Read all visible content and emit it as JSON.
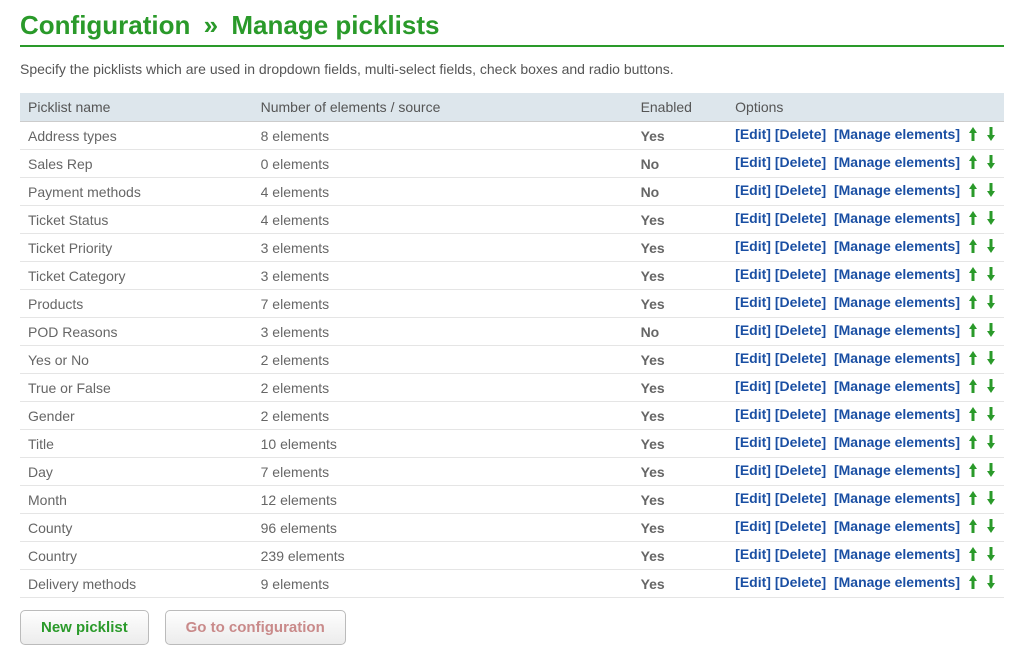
{
  "header": {
    "breadcrumb1": "Configuration",
    "sep": "»",
    "breadcrumb2": "Manage picklists"
  },
  "intro": "Specify the picklists which are used in dropdown fields, multi-select fields, check boxes and radio buttons.",
  "table": {
    "headers": {
      "name": "Picklist name",
      "elements": "Number of elements / source",
      "enabled": "Enabled",
      "options": "Options"
    },
    "option_labels": {
      "edit": "[Edit]",
      "delete": "[Delete]",
      "manage": "[Manage elements]"
    },
    "enabled_labels": {
      "yes": "Yes",
      "no": "No"
    },
    "rows": [
      {
        "name": "Address types",
        "elements": "8 elements",
        "enabled": true
      },
      {
        "name": "Sales Rep",
        "elements": "0 elements",
        "enabled": false
      },
      {
        "name": "Payment methods",
        "elements": "4 elements",
        "enabled": false
      },
      {
        "name": "Ticket Status",
        "elements": "4 elements",
        "enabled": true
      },
      {
        "name": "Ticket Priority",
        "elements": "3 elements",
        "enabled": true
      },
      {
        "name": "Ticket Category",
        "elements": "3 elements",
        "enabled": true
      },
      {
        "name": "Products",
        "elements": "7 elements",
        "enabled": true
      },
      {
        "name": "POD Reasons",
        "elements": "3 elements",
        "enabled": false
      },
      {
        "name": "Yes or No",
        "elements": "2 elements",
        "enabled": true
      },
      {
        "name": "True or False",
        "elements": "2 elements",
        "enabled": true
      },
      {
        "name": "Gender",
        "elements": "2 elements",
        "enabled": true
      },
      {
        "name": "Title",
        "elements": "10 elements",
        "enabled": true
      },
      {
        "name": "Day",
        "elements": "7 elements",
        "enabled": true
      },
      {
        "name": "Month",
        "elements": "12 elements",
        "enabled": true
      },
      {
        "name": "County",
        "elements": "96 elements",
        "enabled": true
      },
      {
        "name": "Country",
        "elements": "239 elements",
        "enabled": true
      },
      {
        "name": "Delivery methods",
        "elements": "9 elements",
        "enabled": true
      }
    ]
  },
  "buttons": {
    "new_picklist": "New picklist",
    "go_to_config": "Go to configuration"
  }
}
